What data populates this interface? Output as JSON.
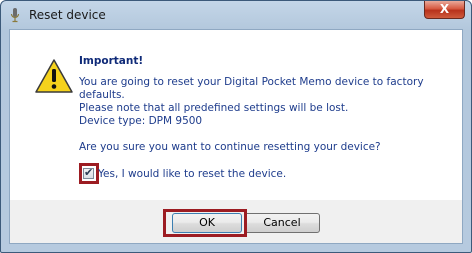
{
  "window": {
    "title": "Reset device",
    "close_symbol": "X",
    "app_icon": "microphone-icon"
  },
  "dialog": {
    "icon": "warning-icon",
    "heading": "Important!",
    "lines": [
      "You are going to reset your Digital Pocket Memo device to factory",
      "defaults.",
      "Please note that all predefined settings will be lost.",
      "Device type: DPM 9500"
    ],
    "question": "Are you sure you want to continue resetting your device?",
    "checkbox": {
      "label": "Yes, I would like to reset the device.",
      "checked": true,
      "check_glyph": "✔"
    }
  },
  "buttons": {
    "ok": "OK",
    "cancel": "Cancel"
  },
  "colors": {
    "highlight": "#9c1c22",
    "message_text": "#1e3c8c"
  }
}
